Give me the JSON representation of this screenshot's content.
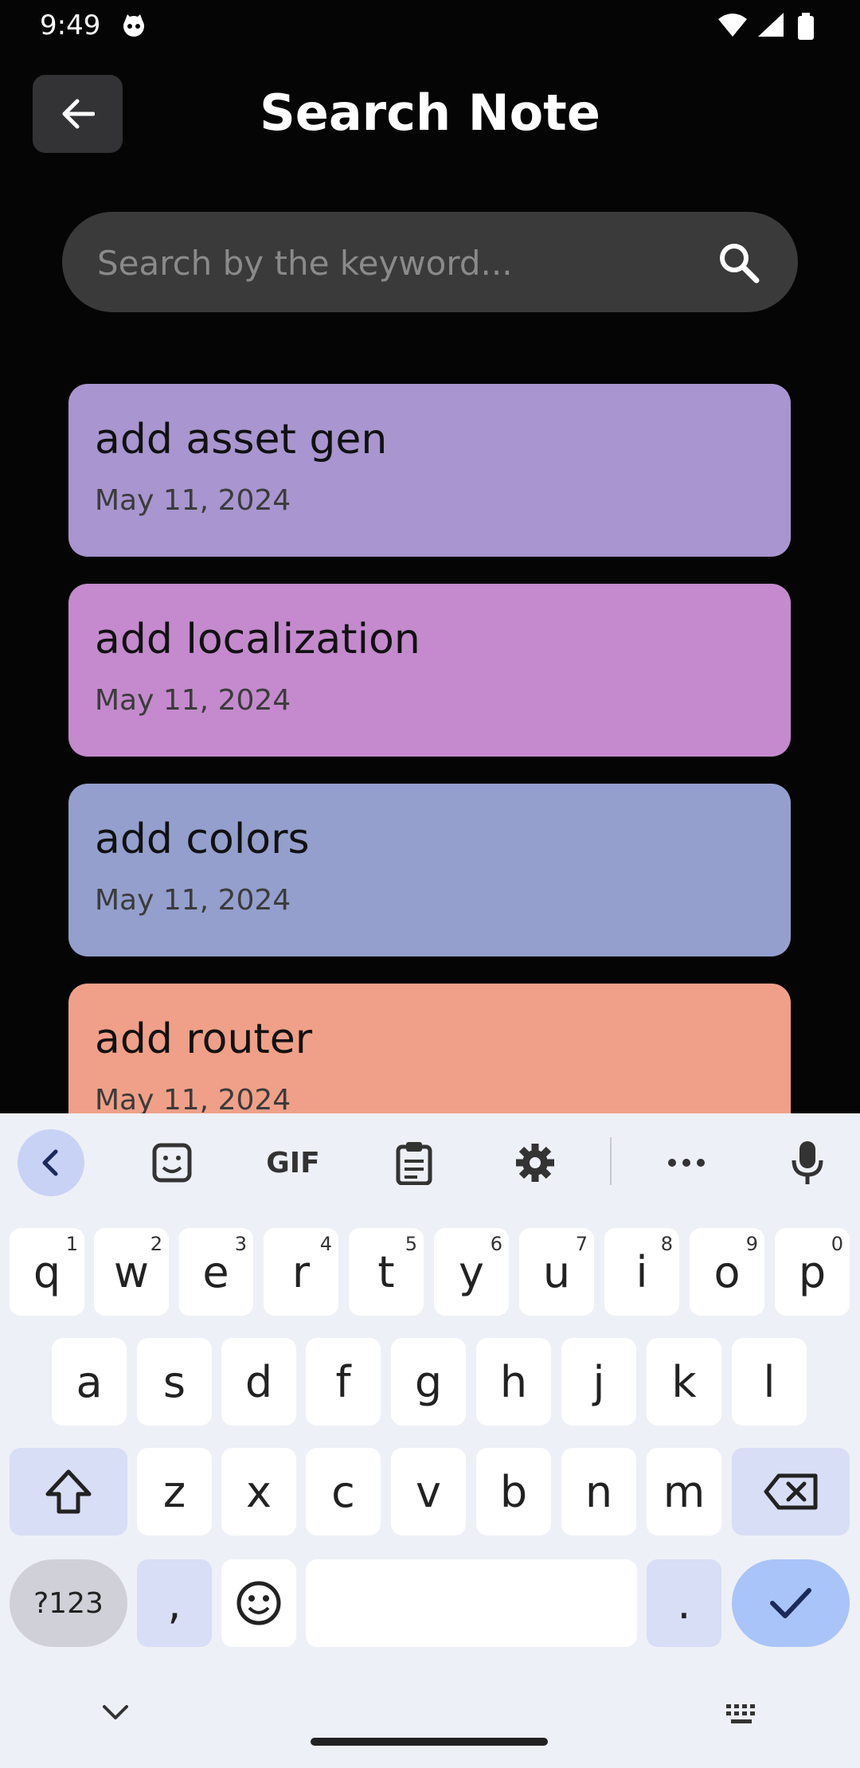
{
  "status": {
    "time": "9:49"
  },
  "header": {
    "title": "Search Note"
  },
  "search": {
    "placeholder": "Search by the keyword..."
  },
  "notes": [
    {
      "title": "add asset gen",
      "date": "May 11, 2024",
      "color": "#a995cf"
    },
    {
      "title": "add localization",
      "date": "May 11, 2024",
      "color": "#c48acd"
    },
    {
      "title": "add colors",
      "date": "May 11, 2024",
      "color": "#949fcd"
    },
    {
      "title": "add router",
      "date": "May 11, 2024",
      "color": "#f0a088"
    }
  ],
  "keyboard": {
    "toolbar": [
      "chevron-left-icon",
      "sticker-icon",
      "gif",
      "clipboard-icon",
      "settings-icon",
      "more-icon",
      "mic-icon"
    ],
    "gif_label": "GIF",
    "row1": [
      {
        "k": "q",
        "h": "1"
      },
      {
        "k": "w",
        "h": "2"
      },
      {
        "k": "e",
        "h": "3"
      },
      {
        "k": "r",
        "h": "4"
      },
      {
        "k": "t",
        "h": "5"
      },
      {
        "k": "y",
        "h": "6"
      },
      {
        "k": "u",
        "h": "7"
      },
      {
        "k": "i",
        "h": "8"
      },
      {
        "k": "o",
        "h": "9"
      },
      {
        "k": "p",
        "h": "0"
      }
    ],
    "row2": [
      "a",
      "s",
      "d",
      "f",
      "g",
      "h",
      "j",
      "k",
      "l"
    ],
    "row3": [
      "z",
      "x",
      "c",
      "v",
      "b",
      "n",
      "m"
    ],
    "sym_label": "?123",
    "comma": ",",
    "period": "."
  }
}
